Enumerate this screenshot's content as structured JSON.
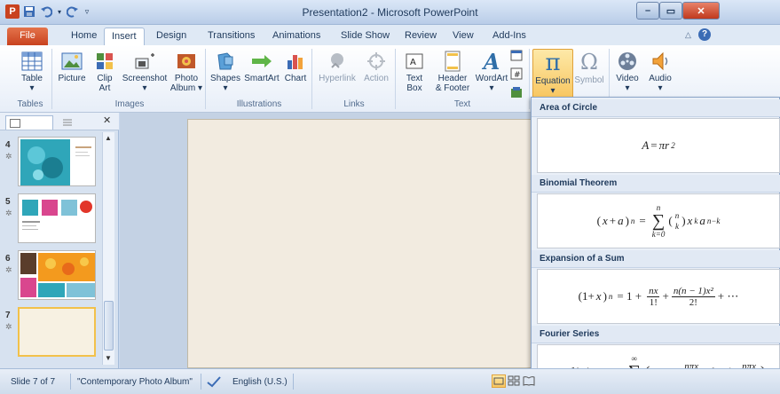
{
  "window": {
    "title": "Presentation2 - Microsoft PowerPoint",
    "minimize": "–",
    "maximize": "▭",
    "close": "✕"
  },
  "tabs": [
    "File",
    "Home",
    "Insert",
    "Design",
    "Transitions",
    "Animations",
    "Slide Show",
    "Review",
    "View",
    "Add-Ins"
  ],
  "ribbon": {
    "table": {
      "label1": "Table",
      "label2": "",
      "group": "Tables"
    },
    "images": {
      "picture": "Picture",
      "clip1": "Clip",
      "clip2": "Art",
      "screenshot": "Screenshot",
      "photo1": "Photo",
      "photo2": "Album ▾",
      "group": "Images"
    },
    "illustrations": {
      "shapes": "Shapes",
      "smartart": "SmartArt",
      "chart": "Chart",
      "group": "Illustrations"
    },
    "links": {
      "hyperlink": "Hyperlink",
      "action": "Action",
      "group": "Links"
    },
    "text": {
      "textbox1": "Text",
      "textbox2": "Box",
      "header1": "Header",
      "header2": "& Footer",
      "wordart": "WordArt",
      "group": "Text"
    },
    "symbols": {
      "equation": "Equation",
      "symbol": "Symbol"
    },
    "media": {
      "video": "Video",
      "audio": "Audio"
    }
  },
  "slides": [
    {
      "num": "4"
    },
    {
      "num": "5"
    },
    {
      "num": "6"
    },
    {
      "num": "7"
    }
  ],
  "gallery": {
    "items": [
      {
        "title": "Area of Circle"
      },
      {
        "title": "Binomial Theorem"
      },
      {
        "title": "Expansion of a Sum"
      },
      {
        "title": "Fourier Series"
      }
    ]
  },
  "status": {
    "slide": "Slide 7 of 7",
    "theme": "\"Contemporary Photo Album\"",
    "language": "English (U.S.)"
  },
  "colors": {
    "accent": "#c9421f",
    "ribbon": "#e7eef8",
    "highlight": "#f2c14a"
  }
}
